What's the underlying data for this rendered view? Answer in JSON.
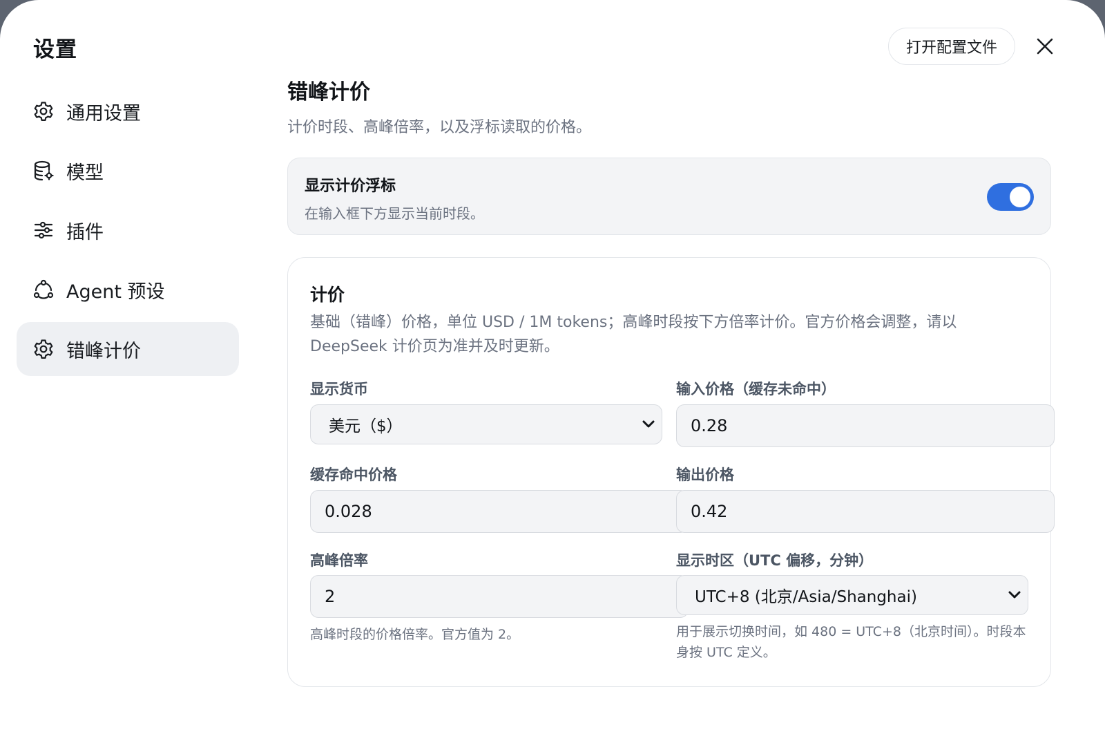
{
  "window": {
    "title": "设置",
    "open_config_label": "打开配置文件"
  },
  "sidebar": {
    "items": [
      {
        "label": "通用设置",
        "icon": "gear-icon",
        "active": false
      },
      {
        "label": "模型",
        "icon": "database-icon",
        "active": false
      },
      {
        "label": "插件",
        "icon": "sliders-icon",
        "active": false
      },
      {
        "label": "Agent 预设",
        "icon": "agent-icon",
        "active": false
      },
      {
        "label": "错峰计价",
        "icon": "gear-icon",
        "active": true
      }
    ]
  },
  "main": {
    "title": "错峰计价",
    "description": "计价时段、高峰倍率，以及浮标读取的价格。",
    "toggle": {
      "title": "显示计价浮标",
      "description": "在输入框下方显示当前时段。",
      "on": true
    },
    "pricing": {
      "title": "计价",
      "description": "基础（错峰）价格，单位 USD / 1M tokens；高峰时段按下方倍率计价。官方价格会调整，请以 DeepSeek 计价页为准并及时更新。",
      "currency_label": "显示货币",
      "currency_value": "美元（$）",
      "input_price_label": "输入价格（缓存未命中）",
      "input_price_value": "0.28",
      "cache_hit_label": "缓存命中价格",
      "cache_hit_value": "0.028",
      "output_price_label": "输出价格",
      "output_price_value": "0.42",
      "peak_rate_label": "高峰倍率",
      "peak_rate_value": "2",
      "peak_rate_hint": "高峰时段的价格倍率。官方值为 2。",
      "timezone_label": "显示时区（UTC 偏移，分钟）",
      "timezone_value": "UTC+8 (北京/Asia/Shanghai)",
      "timezone_hint": "用于展示切换时间，如 480 = UTC+8（北京时间）。时段本身按 UTC 定义。"
    }
  },
  "colors": {
    "accent": "#2f6fe0",
    "active_nav_bg": "#eef0f3",
    "muted_text": "#6b7280"
  }
}
